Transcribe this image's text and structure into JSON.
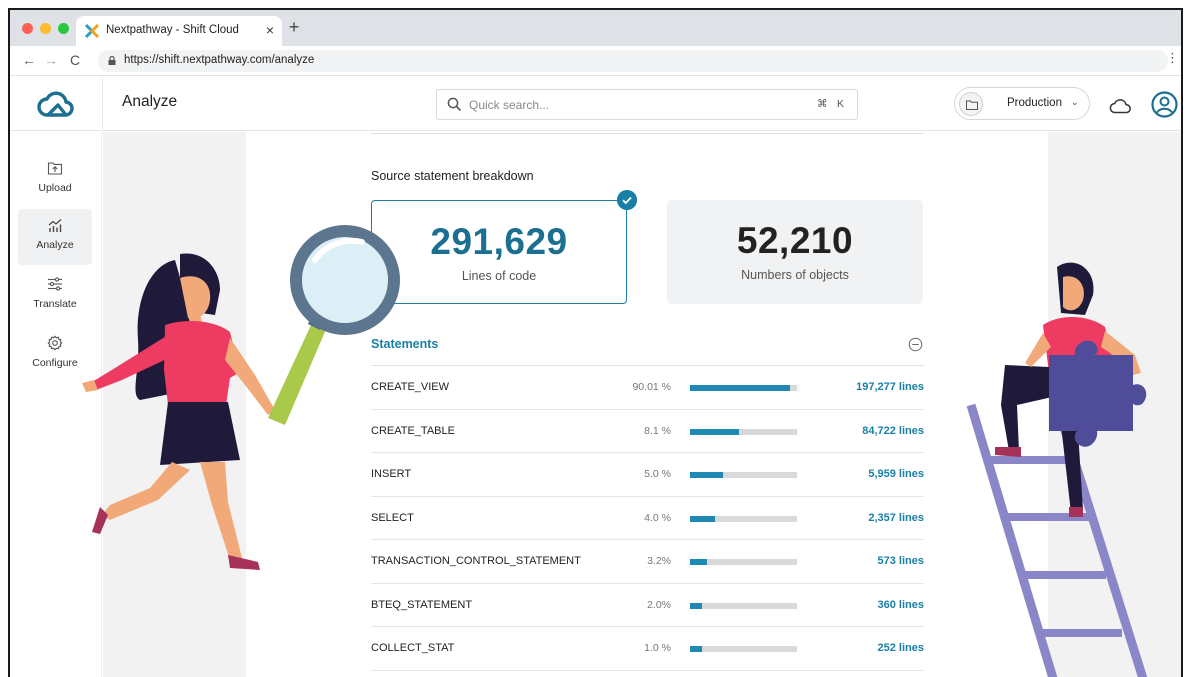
{
  "browser": {
    "tab_title": "Nextpathway - Shift Cloud",
    "tab_close": "×",
    "new_tab": "+",
    "url": "https://shift.nextpathway.com/analyze",
    "nav_back": "←",
    "nav_forward": "→",
    "nav_reload": "C",
    "menu": "⋮"
  },
  "header": {
    "title": "Analyze",
    "search_placeholder": "Quick search...",
    "shortcut_cmd": "⌘",
    "shortcut_key": "K",
    "environment": "Production",
    "environment_chevron": "⌄"
  },
  "sidebar": {
    "items": [
      {
        "label": "Upload",
        "icon": "upload-icon"
      },
      {
        "label": "Analyze",
        "icon": "analyze-icon",
        "active": true
      },
      {
        "label": "Translate",
        "icon": "translate-icon"
      },
      {
        "label": "Configure",
        "icon": "gear-icon"
      }
    ]
  },
  "breakdown": {
    "title": "Source statement breakdown",
    "cards": [
      {
        "value": "291,629",
        "label": "Lines of code",
        "selected": true
      },
      {
        "value": "52,210",
        "label": "Numbers of objects",
        "selected": false
      }
    ]
  },
  "statements": {
    "title": "Statements",
    "rows": [
      {
        "name": "CREATE_VIEW",
        "percent": "90.01 %",
        "fill": 0.93,
        "lines": "197,277 lines"
      },
      {
        "name": "CREATE_TABLE",
        "percent": "8.1 %",
        "fill": 0.46,
        "lines": "84,722 lines"
      },
      {
        "name": "INSERT",
        "percent": "5.0 %",
        "fill": 0.31,
        "lines": "5,959 lines"
      },
      {
        "name": "SELECT",
        "percent": "4.0 %",
        "fill": 0.23,
        "lines": "2,357 lines"
      },
      {
        "name": "TRANSACTION_CONTROL_STATEMENT",
        "percent": "3.2%",
        "fill": 0.16,
        "lines": "573 lines"
      },
      {
        "name": "BTEQ_STATEMENT",
        "percent": "2.0%",
        "fill": 0.11,
        "lines": "360 lines"
      },
      {
        "name": "COLLECT_STAT",
        "percent": "1.0 %",
        "fill": 0.11,
        "lines": "252 lines"
      }
    ]
  },
  "colors": {
    "accent": "#1a7fa6",
    "bar_fill": "#1e8ab3",
    "bar_track": "#d9d9d9"
  }
}
